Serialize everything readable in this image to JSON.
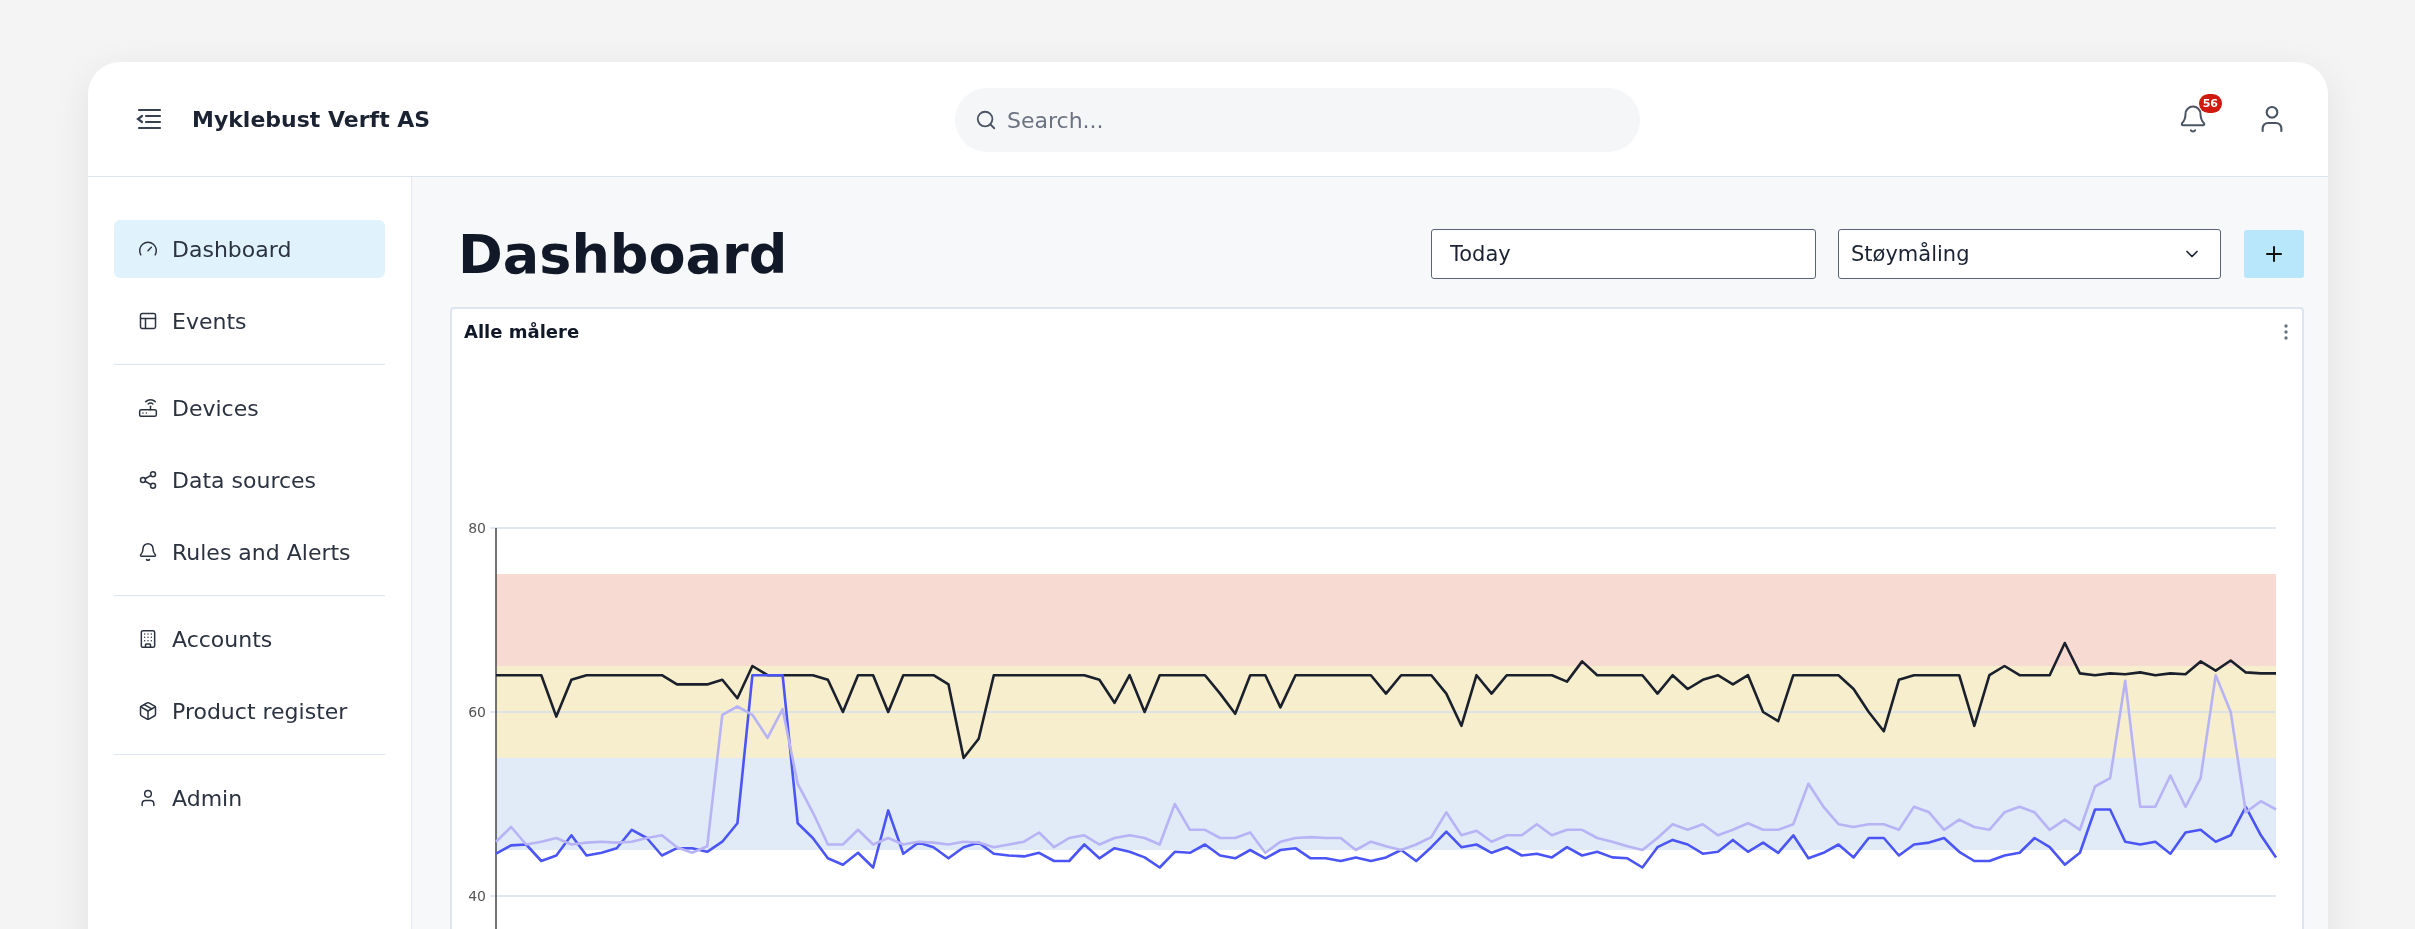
{
  "header": {
    "title": "Myklebust Verft AS",
    "search": {
      "placeholder": "Search..."
    },
    "notifications": {
      "count": "56"
    }
  },
  "sidebar": {
    "groups": [
      {
        "items": [
          {
            "label": "Dashboard",
            "selected": true
          },
          {
            "label": "Events",
            "selected": false
          }
        ]
      },
      {
        "items": [
          {
            "label": "Devices",
            "selected": false
          },
          {
            "label": "Data sources",
            "selected": false
          },
          {
            "label": "Rules and Alerts",
            "selected": false
          }
        ]
      },
      {
        "items": [
          {
            "label": "Accounts",
            "selected": false
          },
          {
            "label": "Product register",
            "selected": false
          }
        ]
      },
      {
        "items": [
          {
            "label": "Admin",
            "selected": false
          }
        ]
      }
    ]
  },
  "page": {
    "title": "Dashboard",
    "date_field": {
      "value": "Today"
    },
    "select": {
      "value": "Støymåling"
    }
  },
  "chart": {
    "title": "Alle målere",
    "chart_data": {
      "type": "line",
      "ylim": [
        36,
        80
      ],
      "yticks": [
        40,
        60,
        80
      ],
      "bands": [
        {
          "axis": "y",
          "from": 65,
          "to": 75,
          "color": "#f7dad2"
        },
        {
          "axis": "y",
          "from": 55,
          "to": 65,
          "color": "#f7eecd"
        },
        {
          "axis": "y",
          "from": 45,
          "to": 55,
          "color": "#e0ebf7"
        }
      ],
      "series": [
        {
          "color": "#1a202c",
          "values": [
            64,
            64,
            64,
            64,
            59.5,
            63.5,
            64,
            64,
            64,
            64,
            64,
            64,
            63,
            63,
            63,
            63.5,
            61.5,
            65,
            64,
            64,
            64,
            64,
            63.5,
            60,
            64,
            64,
            60,
            64,
            64,
            64,
            63,
            55,
            57.1,
            64,
            64,
            64,
            64,
            64,
            64,
            64,
            63.5,
            61,
            64,
            60,
            64,
            64,
            64,
            64,
            62,
            59.8,
            64,
            64,
            60.5,
            64,
            64,
            64,
            64,
            64,
            64,
            62,
            64,
            64,
            64,
            62,
            58.5,
            64,
            62,
            64,
            64,
            64,
            64,
            63.3,
            65.5,
            64,
            64,
            64,
            64,
            62,
            64,
            62.5,
            63.5,
            64,
            63,
            64,
            60,
            59,
            64,
            64,
            64,
            64,
            62.5,
            60,
            57.9,
            63.5,
            64,
            64,
            64,
            64,
            58.5,
            64,
            65,
            64,
            64,
            64,
            67.5,
            64.2,
            64,
            64.2,
            64.1,
            64.3,
            64,
            64.2,
            64.1,
            65.5,
            64.5,
            65.6,
            64.3,
            64.2,
            64.2
          ]
        },
        {
          "color": "#4b55f5",
          "values": [
            44.6,
            45.5,
            45.6,
            43.8,
            44.4,
            46.6,
            44.4,
            44.7,
            45.2,
            47.2,
            46.3,
            44.4,
            45.2,
            45.2,
            44.8,
            45.9,
            47.9,
            64,
            64,
            64,
            47.9,
            46.3,
            44.1,
            43.4,
            44.7,
            43.1,
            49.3,
            44.6,
            45.8,
            45.3,
            44.1,
            45.3,
            45.8,
            44.6,
            44.4,
            44.3,
            44.7,
            43.8,
            43.8,
            45.6,
            44.1,
            45.2,
            44.8,
            44.2,
            43.1,
            44.8,
            44.7,
            45.6,
            44.4,
            44.1,
            45,
            44.1,
            45,
            45.2,
            44.1,
            44.1,
            43.8,
            44.2,
            43.8,
            44.2,
            45,
            43.8,
            45.3,
            47,
            45.3,
            45.6,
            44.7,
            45.3,
            44.4,
            44.6,
            44.2,
            45.3,
            44.4,
            44.8,
            44.2,
            44.1,
            43.1,
            45.3,
            46.1,
            45.6,
            44.6,
            44.8,
            46.1,
            44.8,
            45.8,
            44.7,
            46.6,
            44.1,
            44.7,
            45.6,
            44.2,
            46.3,
            46.3,
            44.4,
            45.6,
            45.8,
            46.3,
            44.8,
            43.8,
            43.8,
            44.4,
            44.7,
            46.3,
            45.3,
            43.4,
            44.7,
            49.4,
            49.4,
            45.9,
            45.6,
            45.9,
            44.6,
            46.9,
            47.2,
            45.9,
            46.6,
            49.7,
            46.6,
            44.2
          ]
        },
        {
          "color": "#b7b3f5",
          "values": [
            45.9,
            47.5,
            45.6,
            45.9,
            46.3,
            45.6,
            45.8,
            45.9,
            45.8,
            45.9,
            46.3,
            46.6,
            45.3,
            44.7,
            45.4,
            59.7,
            60.6,
            59.7,
            57.2,
            60.3,
            52.2,
            49.1,
            45.6,
            45.6,
            47.2,
            45.6,
            46.3,
            45.6,
            45.9,
            45.8,
            45.6,
            45.9,
            45.8,
            45.3,
            45.6,
            45.9,
            46.9,
            45.3,
            46.3,
            46.6,
            45.6,
            46.3,
            46.6,
            46.3,
            45.6,
            50,
            47.2,
            47.2,
            46.3,
            46.3,
            46.9,
            44.7,
            45.9,
            46.3,
            46.4,
            46.3,
            46.3,
            45,
            45.9,
            45.4,
            45,
            45.6,
            46.4,
            49.1,
            46.6,
            47.1,
            45.9,
            46.6,
            46.6,
            47.8,
            46.6,
            47.2,
            47.2,
            46.3,
            45.9,
            45.4,
            45,
            46.3,
            47.8,
            47.2,
            47.8,
            46.6,
            47.2,
            47.9,
            47.2,
            47.2,
            47.8,
            52.2,
            49.7,
            47.8,
            47.5,
            47.8,
            47.8,
            47.2,
            49.7,
            49.1,
            47.2,
            48.3,
            47.5,
            47.2,
            49.1,
            49.7,
            49.1,
            47.2,
            48.3,
            47.2,
            51.9,
            52.8,
            63.4,
            49.7,
            49.7,
            53.1,
            49.7,
            52.8,
            64,
            60,
            49.1,
            50.3,
            49.4
          ]
        }
      ]
    }
  }
}
